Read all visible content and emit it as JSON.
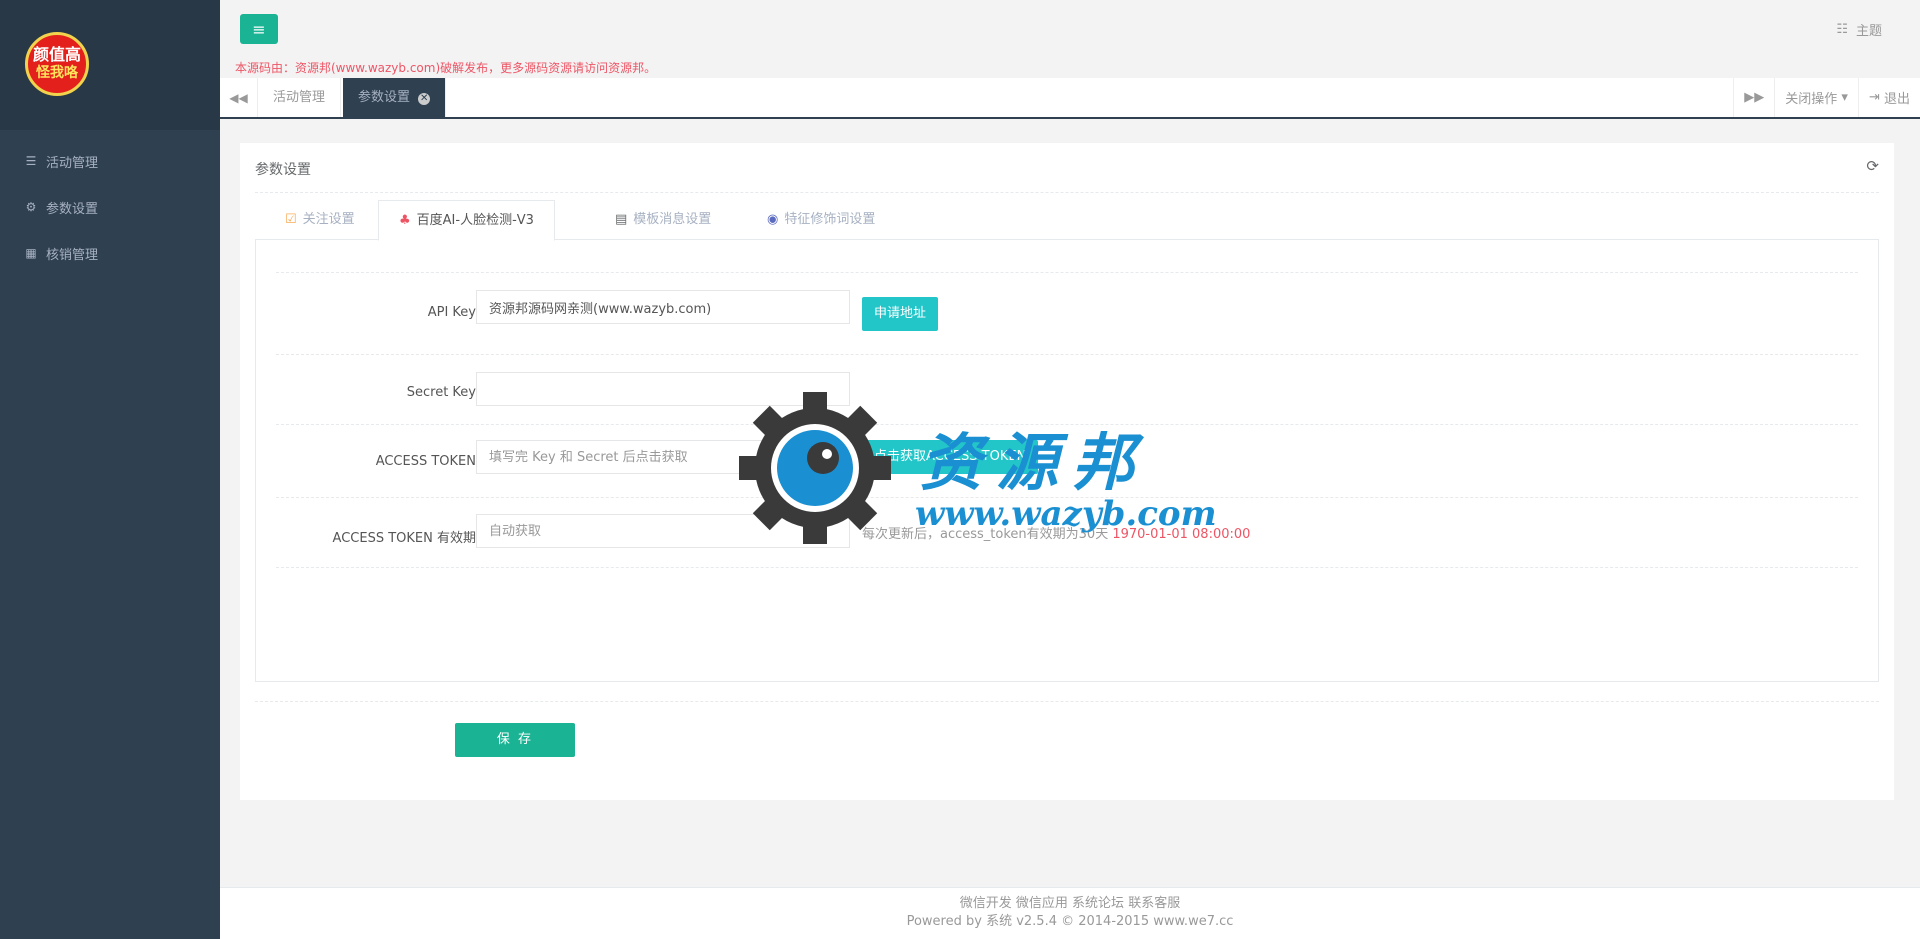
{
  "sidebar": {
    "logo_line1": "颜值高",
    "logo_line2": "怪我咯",
    "items": [
      {
        "label": "活动管理",
        "icon": "list-icon"
      },
      {
        "label": "参数设置",
        "icon": "gear-icon"
      },
      {
        "label": "核销管理",
        "icon": "grid-icon"
      }
    ]
  },
  "topbar": {
    "theme_label": "主题",
    "notice": "本源码由：资源邦(www.wazyb.com)破解发布，更多源码资源请访问资源邦。"
  },
  "tabbar": {
    "tabs": [
      "活动管理",
      "参数设置"
    ],
    "close_ops": "关闭操作",
    "logout": "退出"
  },
  "panel": {
    "title": "参数设置",
    "tabs": [
      "关注设置",
      "百度AI-人脸检测-V3",
      "模板消息设置",
      "特征修饰词设置"
    ],
    "active_tab": 1,
    "fields": {
      "api_key_label": "API Key",
      "api_key_value": "资源邦源码网亲测(www.wazyb.com)",
      "apply_btn": "申请地址",
      "secret_key_label": "Secret Key",
      "secret_key_value": "",
      "access_token_label": "ACCESS TOKEN",
      "access_token_placeholder": "填写完 Key 和 Secret 后点击获取",
      "get_token_btn": "点击获取ACCESS TOKEN",
      "expire_label": "ACCESS TOKEN 有效期",
      "expire_placeholder": "自动获取",
      "expire_help": "每次更新后，access_token有效期为30天 ",
      "expire_date": "1970-01-01 08:00:00"
    },
    "save_btn": "保 存"
  },
  "watermark": {
    "title": "资源邦",
    "url": "www.wazyb.com"
  },
  "footer": {
    "links": "微信开发 微信应用 系统论坛 联系客服",
    "powered": "Powered by 系统 v2.5.4 © 2014-2015 www.we7.cc"
  }
}
